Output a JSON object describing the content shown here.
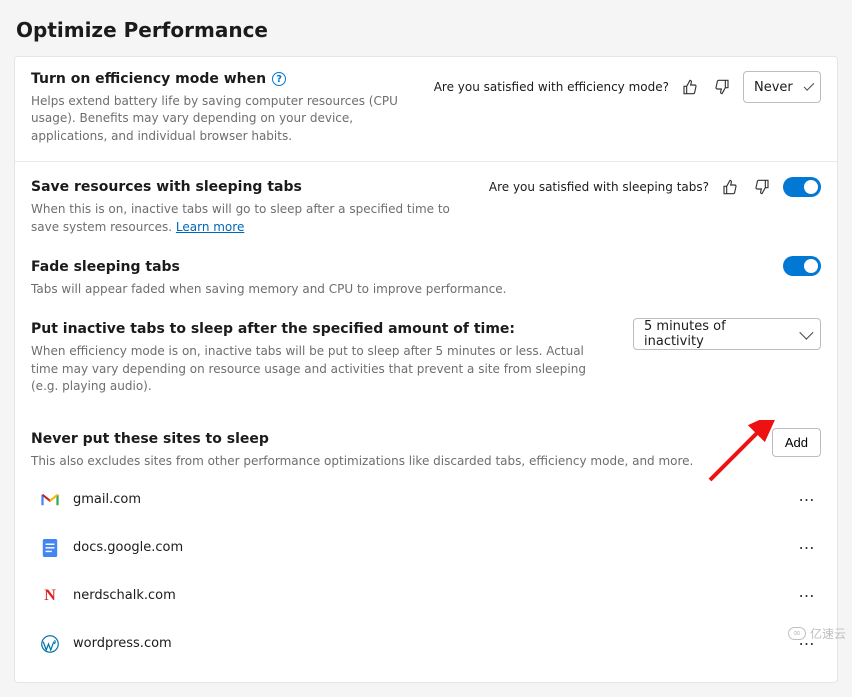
{
  "page_title": "Optimize Performance",
  "efficiency": {
    "title": "Turn on efficiency mode when",
    "desc": "Helps extend battery life by saving computer resources (CPU usage). Benefits may vary depending on your device, applications, and individual browser habits.",
    "feedback_q": "Are you satisfied with efficiency mode?",
    "select_value": "Never"
  },
  "sleeping": {
    "title": "Save resources with sleeping tabs",
    "desc_pre": "When this is on, inactive tabs will go to sleep after a specified time to save system resources. ",
    "learn_more": "Learn more",
    "feedback_q": "Are you satisfied with sleeping tabs?",
    "toggle_on": true
  },
  "fade": {
    "title": "Fade sleeping tabs",
    "desc": "Tabs will appear faded when saving memory and CPU to improve performance.",
    "toggle_on": true
  },
  "inactive": {
    "title": "Put inactive tabs to sleep after the specified amount of time:",
    "desc": "When efficiency mode is on, inactive tabs will be put to sleep after 5 minutes or less. Actual time may vary depending on resource usage and activities that prevent a site from sleeping (e.g. playing audio).",
    "select_value": "5 minutes of inactivity"
  },
  "never_sleep": {
    "title": "Never put these sites to sleep",
    "desc": "This also excludes sites from other performance optimizations like discarded tabs, efficiency mode, and more.",
    "add_label": "Add",
    "sites": [
      {
        "name": "gmail.com",
        "icon": "gmail"
      },
      {
        "name": "docs.google.com",
        "icon": "docs"
      },
      {
        "name": "nerdschalk.com",
        "icon": "n"
      },
      {
        "name": "wordpress.com",
        "icon": "wp"
      }
    ]
  },
  "watermark": "亿速云"
}
